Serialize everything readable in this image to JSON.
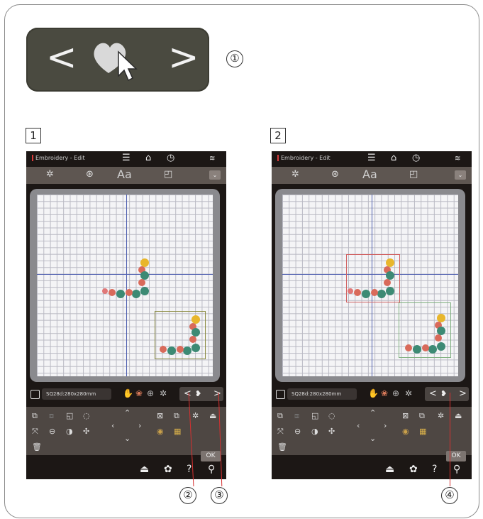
{
  "callouts": {
    "c1": "①",
    "c2": "②",
    "c3": "③",
    "c4": "④"
  },
  "steps": {
    "s1": "1",
    "s2": "2"
  },
  "button_graphic": {
    "left": "<",
    "right": ">"
  },
  "screen": {
    "title": "Embroidery - Edit",
    "tabs": [
      "✲",
      "⊛",
      "Aa",
      "◰"
    ],
    "size_label": "SQ28d:280x280mm",
    "nav_prev": "<",
    "nav_next": ">",
    "ok_label": "OK",
    "menu_icon": "☰",
    "home_icon": "⌂",
    "clock_icon": "◷",
    "wifi_icon": "≋"
  },
  "colors": {
    "accent": "#d63030",
    "grid_axis": "#5060b0",
    "select1": "#8a8a40",
    "select2_red": "#d06060",
    "select2_green": "#80b080"
  }
}
